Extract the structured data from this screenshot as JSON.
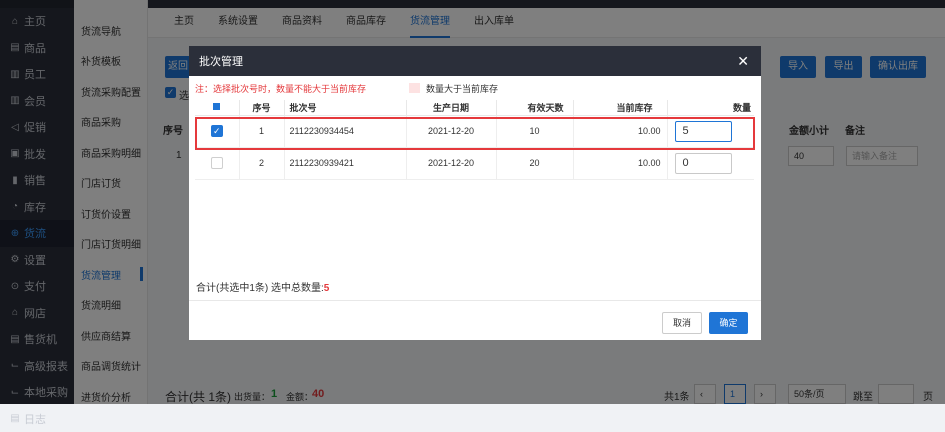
{
  "nav": {
    "items": [
      {
        "icon": "home-icon",
        "glyph": "⌂",
        "label": "主页"
      },
      {
        "icon": "goods-icon",
        "glyph": "▤",
        "label": "商品"
      },
      {
        "icon": "staff-icon",
        "glyph": "▥",
        "label": "员工"
      },
      {
        "icon": "member-icon",
        "glyph": "▥",
        "label": "会员"
      },
      {
        "icon": "promo-icon",
        "glyph": "◁",
        "label": "促销"
      },
      {
        "icon": "wholesale-icon",
        "glyph": "▣",
        "label": "批发"
      },
      {
        "icon": "sales-icon",
        "glyph": "▮",
        "label": "销售"
      },
      {
        "icon": "stock-icon",
        "glyph": "◔",
        "label": "库存"
      },
      {
        "icon": "flow-icon",
        "glyph": "⊕",
        "label": "货流"
      },
      {
        "icon": "settings-icon",
        "glyph": "⚙",
        "label": "设置"
      },
      {
        "icon": "pay-icon",
        "glyph": "⊙",
        "label": "支付"
      },
      {
        "icon": "store-icon",
        "glyph": "⌂",
        "label": "网店"
      },
      {
        "icon": "vending-icon",
        "glyph": "▤",
        "label": "售货机"
      },
      {
        "icon": "report-icon",
        "glyph": "⌙",
        "label": "高级报表"
      },
      {
        "icon": "local-purchase-icon",
        "glyph": "⌙",
        "label": "本地采购"
      },
      {
        "icon": "log-icon",
        "glyph": "▤",
        "label": "日志"
      }
    ],
    "active_index": 8
  },
  "subnav": {
    "items": [
      "货流导航",
      "补货模板",
      "货流采购配置",
      "商品采购",
      "商品采购明细",
      "门店订货",
      "订货价设置",
      "门店订货明细",
      "货流管理",
      "货流明细",
      "供应商结算",
      "商品调货统计",
      "进货价分析"
    ],
    "active_index": 8
  },
  "tabs": {
    "items": [
      "主页",
      "系统设置",
      "商品资料",
      "商品库存",
      "货流管理",
      "出入库单"
    ],
    "active_index": 4
  },
  "background": {
    "left_btn": "返回",
    "import_label": "导入",
    "export_label": "导出",
    "confirm_label": "确认出库",
    "check_label": "选",
    "col_seq": "序号",
    "col_amount": "金额小计",
    "col_remark": "备注",
    "row_seq": "1",
    "row_amount": "40",
    "remark_placeholder": "请输入备注",
    "footer_total": "合计(共 1条)",
    "footer_qty_label": "出货量：",
    "footer_qty": "1",
    "footer_amount_label": "金额：",
    "footer_amount": "40",
    "pager_total": "共1条",
    "pager_page": "1",
    "pager_size": "50条/页",
    "pager_jump": "跳至",
    "pager_unit": "页"
  },
  "modal": {
    "title": "批次管理",
    "note": "注：选择批次号时，数量不能大于当前库存",
    "legend": "数量大于当前库存",
    "columns": [
      "序号",
      "批次号",
      "生产日期",
      "有效天数",
      "当前库存",
      "数量"
    ],
    "rows": [
      {
        "checked": true,
        "seq": "1",
        "batch": "2112230934454",
        "date": "2021-12-20",
        "days": "10",
        "stock": "10.00",
        "qty": "5"
      },
      {
        "checked": false,
        "seq": "2",
        "batch": "2112230939421",
        "date": "2021-12-20",
        "days": "20",
        "stock": "10.00",
        "qty": "0"
      }
    ],
    "summary_prefix": "合计(共选中1条)  选中总数量:",
    "summary_total": "5",
    "cancel_label": "取消",
    "ok_label": "确定"
  },
  "colors": {
    "accent": "#1f75d6",
    "danger": "#e4393c",
    "nav_bg": "#2b2f3a"
  }
}
